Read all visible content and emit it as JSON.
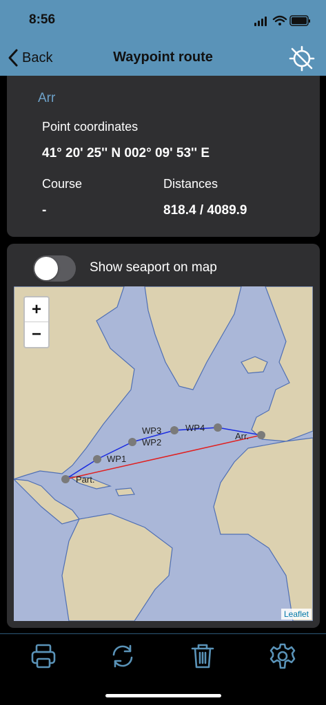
{
  "status": {
    "time": "8:56"
  },
  "nav": {
    "back_label": "Back",
    "title": "Waypoint route"
  },
  "point": {
    "name": "Arr",
    "coords_label": "Point coordinates",
    "coords_value": "41° 20' 25'' N 002° 09' 53'' E",
    "course_label": "Course",
    "course_value": "-",
    "distances_label": "Distances",
    "distances_value": "818.4 / 4089.9"
  },
  "map_panel": {
    "toggle_label": "Show seaport on map",
    "toggle_on": false,
    "zoom_in": "+",
    "zoom_out": "−",
    "attribution": "Leaflet",
    "waypoints": [
      "Part.",
      "WP1",
      "WP2",
      "WP3",
      "WP4",
      "Arr."
    ]
  },
  "colors": {
    "accent": "#5a93b8",
    "route_line": "#1a2be0",
    "direct_line": "#e02020",
    "sea": "#aab7d8",
    "land": "#dcd1b0"
  },
  "toolbar": [
    "printer-icon",
    "refresh-icon",
    "trash-icon",
    "gear-icon"
  ]
}
